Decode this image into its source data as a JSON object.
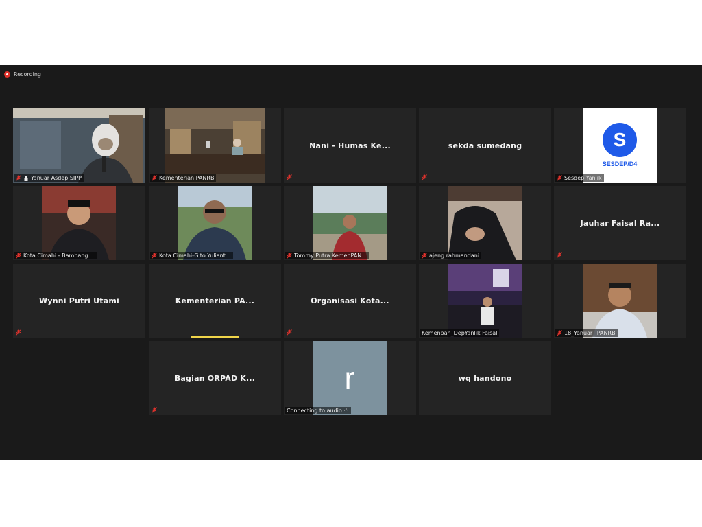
{
  "recording": {
    "label": "Recording"
  },
  "tiles": [
    {
      "name": "Yanuar Asdep SIPP"
    },
    {
      "name": "Kementerian PANRB"
    },
    {
      "name": "Nani - Humas Ke..."
    },
    {
      "name": "sekda sumedang"
    },
    {
      "name": "Sesdep Yanlik",
      "logo_letter": "S",
      "logo_text": "SESDEP/D4"
    },
    {
      "name": "Kota Cimahi - Bambang ..."
    },
    {
      "name": "Kota Cimahi-Gito Yuliant..."
    },
    {
      "name": "Tommy Putra KemenPAN..."
    },
    {
      "name": "ajeng rahmandani"
    },
    {
      "name": "Jauhar Faisal Ra..."
    },
    {
      "name": "Wynni Putri Utami"
    },
    {
      "name": "Kementerian PA..."
    },
    {
      "name": "Organisasi Kota..."
    },
    {
      "name": "Kemenpan_DepYanlik Faisal"
    },
    {
      "name": "18_Yanuar_ PANRB"
    },
    {
      "name": "Bagian ORPAD K..."
    },
    {
      "name": "Connecting to audio ·'·",
      "avatar_letter": "r"
    },
    {
      "name": "wq handono"
    }
  ],
  "colors": {
    "active_border": "#c9e07a",
    "speaker_bar": "#f0d54a",
    "muted_icon": "#e0322c",
    "logo_blue": "#1f5ae8",
    "avatar_bg": "#7d929e"
  }
}
